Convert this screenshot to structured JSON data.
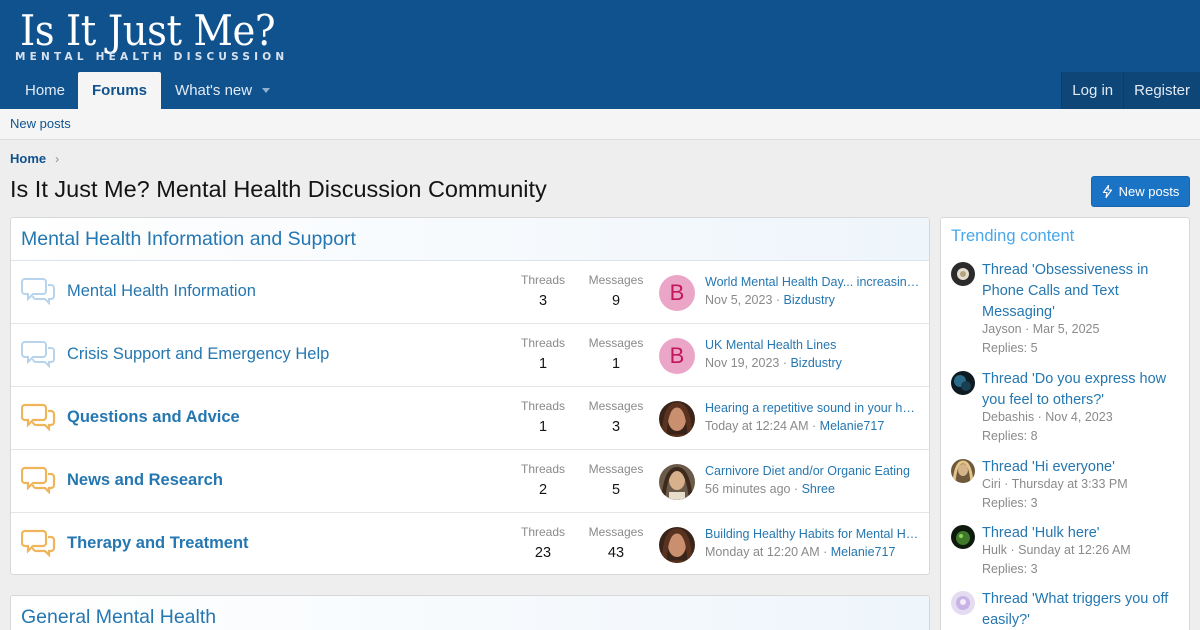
{
  "site": {
    "logo_title": "Is It Just Me?",
    "logo_subtitle": "MENTAL HEALTH DISCUSSION",
    "brand_color": "#10528e",
    "accent_color": "#2577b1"
  },
  "nav": {
    "tabs": [
      {
        "label": "Home"
      },
      {
        "label": "Forums"
      },
      {
        "label": "What's new"
      }
    ],
    "login": "Log in",
    "register": "Register"
  },
  "subnav": {
    "new_posts": "New posts"
  },
  "breadcrumb": {
    "home": "Home"
  },
  "page": {
    "title": "Is It Just Me? Mental Health Discussion Community",
    "new_posts_button": "New posts"
  },
  "categories": [
    {
      "title": "Mental Health Information and Support",
      "forums": [
        {
          "title": "Mental Health Information",
          "threads_label": "Threads",
          "threads": "3",
          "messages_label": "Messages",
          "messages": "9",
          "avatar_letter": "B",
          "last_title": "World Mental Health Day... increasing awareness",
          "last_date": "Nov 5, 2023",
          "last_user": "Bizdustry",
          "icon": "chat-bubbles-icon"
        },
        {
          "title": "Crisis Support and Emergency Help",
          "threads_label": "Threads",
          "threads": "1",
          "messages_label": "Messages",
          "messages": "1",
          "avatar_letter": "B",
          "last_title": "UK Mental Health Lines",
          "last_date": "Nov 19, 2023",
          "last_user": "Bizdustry",
          "icon": "chat-bubbles-icon"
        },
        {
          "title": "Questions and Advice",
          "threads_label": "Threads",
          "threads": "1",
          "messages_label": "Messages",
          "messages": "3",
          "avatar_letter": "",
          "last_title": "Hearing a repetitive sound in your head",
          "last_date": "Today at 12:24 AM",
          "last_user": "Melanie717",
          "icon": "chat-bubbles-unread-icon"
        },
        {
          "title": "News and Research",
          "threads_label": "Threads",
          "threads": "2",
          "messages_label": "Messages",
          "messages": "5",
          "avatar_letter": "",
          "last_title": "Carnivore Diet and/or Organic Eating",
          "last_date": "56 minutes ago",
          "last_user": "Shree",
          "icon": "chat-bubbles-unread-icon"
        },
        {
          "title": "Therapy and Treatment",
          "threads_label": "Threads",
          "threads": "23",
          "messages_label": "Messages",
          "messages": "43",
          "avatar_letter": "",
          "last_title": "Building Healthy Habits for Mental Health",
          "last_date": "Monday at 12:20 AM",
          "last_user": "Melanie717",
          "icon": "chat-bubbles-unread-icon"
        }
      ]
    },
    {
      "title": "General Mental Health"
    }
  ],
  "sidebar": {
    "title": "Trending content",
    "items": [
      {
        "title": "Thread 'Obsessiveness in Phone Calls and Text Messaging'",
        "user": "Jayson",
        "date": "Mar 5, 2025",
        "replies": "Replies: 5"
      },
      {
        "title": "Thread 'Do you express how you feel to others?'",
        "user": "Debashis",
        "date": "Nov 4, 2023",
        "replies": "Replies: 8"
      },
      {
        "title": "Thread 'Hi everyone'",
        "user": "Ciri",
        "date": "Thursday at 3:33 PM",
        "replies": "Replies: 3"
      },
      {
        "title": "Thread 'Hulk here'",
        "user": "Hulk",
        "date": "Sunday at 12:26 AM",
        "replies": "Replies: 3"
      },
      {
        "title": "Thread 'What triggers you off easily?'",
        "user": "",
        "date": "",
        "replies": ""
      }
    ]
  }
}
